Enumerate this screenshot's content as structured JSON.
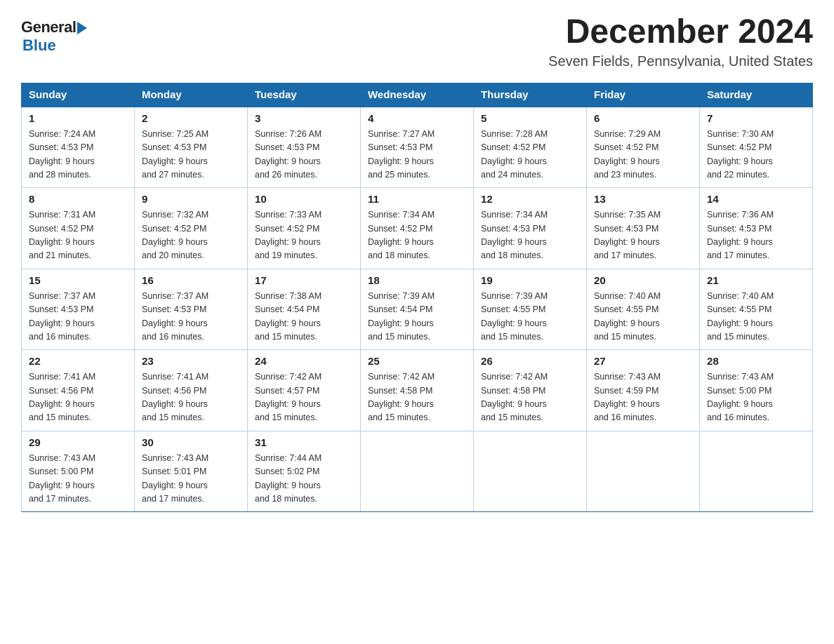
{
  "header": {
    "logo": {
      "general_text": "General",
      "blue_text": "Blue"
    },
    "title": "December 2024",
    "location": "Seven Fields, Pennsylvania, United States"
  },
  "weekdays": [
    "Sunday",
    "Monday",
    "Tuesday",
    "Wednesday",
    "Thursday",
    "Friday",
    "Saturday"
  ],
  "weeks": [
    [
      {
        "day": "1",
        "sunrise": "7:24 AM",
        "sunset": "4:53 PM",
        "daylight": "9 hours and 28 minutes."
      },
      {
        "day": "2",
        "sunrise": "7:25 AM",
        "sunset": "4:53 PM",
        "daylight": "9 hours and 27 minutes."
      },
      {
        "day": "3",
        "sunrise": "7:26 AM",
        "sunset": "4:53 PM",
        "daylight": "9 hours and 26 minutes."
      },
      {
        "day": "4",
        "sunrise": "7:27 AM",
        "sunset": "4:53 PM",
        "daylight": "9 hours and 25 minutes."
      },
      {
        "day": "5",
        "sunrise": "7:28 AM",
        "sunset": "4:52 PM",
        "daylight": "9 hours and 24 minutes."
      },
      {
        "day": "6",
        "sunrise": "7:29 AM",
        "sunset": "4:52 PM",
        "daylight": "9 hours and 23 minutes."
      },
      {
        "day": "7",
        "sunrise": "7:30 AM",
        "sunset": "4:52 PM",
        "daylight": "9 hours and 22 minutes."
      }
    ],
    [
      {
        "day": "8",
        "sunrise": "7:31 AM",
        "sunset": "4:52 PM",
        "daylight": "9 hours and 21 minutes."
      },
      {
        "day": "9",
        "sunrise": "7:32 AM",
        "sunset": "4:52 PM",
        "daylight": "9 hours and 20 minutes."
      },
      {
        "day": "10",
        "sunrise": "7:33 AM",
        "sunset": "4:52 PM",
        "daylight": "9 hours and 19 minutes."
      },
      {
        "day": "11",
        "sunrise": "7:34 AM",
        "sunset": "4:52 PM",
        "daylight": "9 hours and 18 minutes."
      },
      {
        "day": "12",
        "sunrise": "7:34 AM",
        "sunset": "4:53 PM",
        "daylight": "9 hours and 18 minutes."
      },
      {
        "day": "13",
        "sunrise": "7:35 AM",
        "sunset": "4:53 PM",
        "daylight": "9 hours and 17 minutes."
      },
      {
        "day": "14",
        "sunrise": "7:36 AM",
        "sunset": "4:53 PM",
        "daylight": "9 hours and 17 minutes."
      }
    ],
    [
      {
        "day": "15",
        "sunrise": "7:37 AM",
        "sunset": "4:53 PM",
        "daylight": "9 hours and 16 minutes."
      },
      {
        "day": "16",
        "sunrise": "7:37 AM",
        "sunset": "4:53 PM",
        "daylight": "9 hours and 16 minutes."
      },
      {
        "day": "17",
        "sunrise": "7:38 AM",
        "sunset": "4:54 PM",
        "daylight": "9 hours and 15 minutes."
      },
      {
        "day": "18",
        "sunrise": "7:39 AM",
        "sunset": "4:54 PM",
        "daylight": "9 hours and 15 minutes."
      },
      {
        "day": "19",
        "sunrise": "7:39 AM",
        "sunset": "4:55 PM",
        "daylight": "9 hours and 15 minutes."
      },
      {
        "day": "20",
        "sunrise": "7:40 AM",
        "sunset": "4:55 PM",
        "daylight": "9 hours and 15 minutes."
      },
      {
        "day": "21",
        "sunrise": "7:40 AM",
        "sunset": "4:55 PM",
        "daylight": "9 hours and 15 minutes."
      }
    ],
    [
      {
        "day": "22",
        "sunrise": "7:41 AM",
        "sunset": "4:56 PM",
        "daylight": "9 hours and 15 minutes."
      },
      {
        "day": "23",
        "sunrise": "7:41 AM",
        "sunset": "4:56 PM",
        "daylight": "9 hours and 15 minutes."
      },
      {
        "day": "24",
        "sunrise": "7:42 AM",
        "sunset": "4:57 PM",
        "daylight": "9 hours and 15 minutes."
      },
      {
        "day": "25",
        "sunrise": "7:42 AM",
        "sunset": "4:58 PM",
        "daylight": "9 hours and 15 minutes."
      },
      {
        "day": "26",
        "sunrise": "7:42 AM",
        "sunset": "4:58 PM",
        "daylight": "9 hours and 15 minutes."
      },
      {
        "day": "27",
        "sunrise": "7:43 AM",
        "sunset": "4:59 PM",
        "daylight": "9 hours and 16 minutes."
      },
      {
        "day": "28",
        "sunrise": "7:43 AM",
        "sunset": "5:00 PM",
        "daylight": "9 hours and 16 minutes."
      }
    ],
    [
      {
        "day": "29",
        "sunrise": "7:43 AM",
        "sunset": "5:00 PM",
        "daylight": "9 hours and 17 minutes."
      },
      {
        "day": "30",
        "sunrise": "7:43 AM",
        "sunset": "5:01 PM",
        "daylight": "9 hours and 17 minutes."
      },
      {
        "day": "31",
        "sunrise": "7:44 AM",
        "sunset": "5:02 PM",
        "daylight": "9 hours and 18 minutes."
      },
      null,
      null,
      null,
      null
    ]
  ],
  "labels": {
    "sunrise": "Sunrise:",
    "sunset": "Sunset:",
    "daylight": "Daylight:"
  }
}
